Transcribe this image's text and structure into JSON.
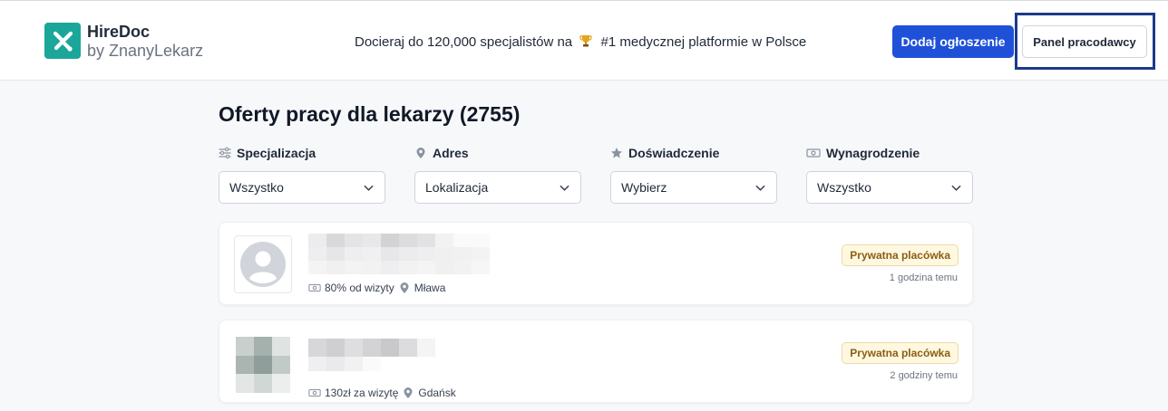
{
  "header": {
    "brand_title": "HireDoc",
    "brand_subtitle": "by ZnanyLekarz",
    "tagline_before": "Docieraj do 120,000 specjalistów na",
    "tagline_after": "#1 medycznej platformie w Polsce",
    "add_listing_label": "Dodaj ogłoszenie",
    "employer_panel_label": "Panel pracodawcy"
  },
  "main": {
    "title": "Oferty pracy dla lekarzy (2755)",
    "filters": [
      {
        "label": "Specjalizacja",
        "value": "Wszystko",
        "icon": "sliders-icon"
      },
      {
        "label": "Adres",
        "value": "Lokalizacja",
        "icon": "map-pin-icon"
      },
      {
        "label": "Doświadczenie",
        "value": "Wybierz",
        "icon": "star-icon"
      },
      {
        "label": "Wynagrodzenie",
        "value": "Wszystko",
        "icon": "money-icon"
      }
    ],
    "jobs": [
      {
        "salary": "80% od wizyty",
        "city": "Mława",
        "badge": "Prywatna placówka",
        "posted": "1 godzina temu"
      },
      {
        "salary": "130zł za wizytę",
        "city": "Gdańsk",
        "badge": "Prywatna placówka",
        "posted": "2 godziny temu"
      }
    ]
  },
  "colors": {
    "brand_teal": "#1aa79a",
    "primary_blue": "#1f51d8",
    "focus_outline": "#1b3a8a",
    "badge_bg": "#fff8e1",
    "badge_text": "#8b5e10"
  }
}
